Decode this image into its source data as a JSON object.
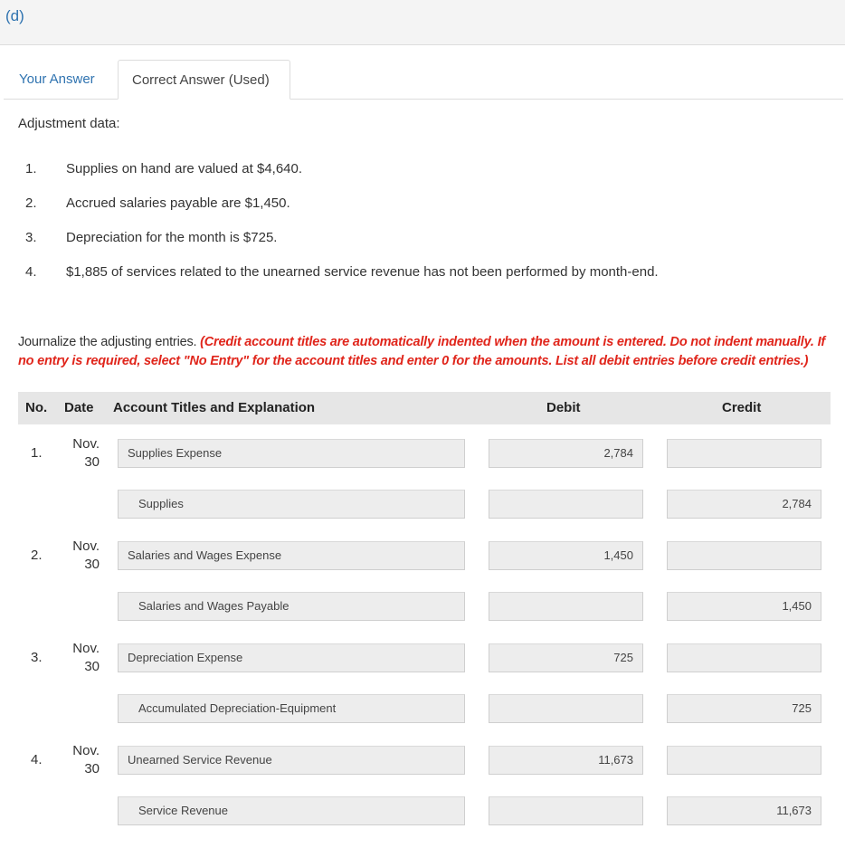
{
  "part": {
    "label": "(d)"
  },
  "tabs": [
    {
      "label": "Your Answer",
      "active": false
    },
    {
      "label": "Correct Answer (Used)",
      "active": true
    }
  ],
  "adjustment": {
    "title": "Adjustment data:",
    "items": [
      {
        "num": "1.",
        "text": "Supplies on hand are valued at $4,640."
      },
      {
        "num": "2.",
        "text": "Accrued salaries payable are $1,450."
      },
      {
        "num": "3.",
        "text": "Depreciation for the month is $725."
      },
      {
        "num": "4.",
        "text": "$1,885 of services related to the unearned service revenue has not been performed by month-end."
      }
    ]
  },
  "instructions": {
    "text": "Journalize the adjusting entries. ",
    "note": "(Credit account titles are automatically indented when the amount is entered. Do not indent manually. If no entry is required, select \"No Entry\" for the account titles and enter 0 for the amounts. List all debit entries before credit entries.)"
  },
  "table": {
    "headers": {
      "no": "No.",
      "date": "Date",
      "account": "Account Titles and Explanation",
      "debit": "Debit",
      "credit": "Credit"
    },
    "entries": [
      {
        "no": "1.",
        "date_month": "Nov.",
        "date_day": "30",
        "debit_line": {
          "account": "Supplies Expense",
          "debit": "2,784",
          "credit": ""
        },
        "credit_line": {
          "account": "Supplies",
          "debit": "",
          "credit": "2,784"
        }
      },
      {
        "no": "2.",
        "date_month": "Nov.",
        "date_day": "30",
        "debit_line": {
          "account": "Salaries and Wages Expense",
          "debit": "1,450",
          "credit": ""
        },
        "credit_line": {
          "account": "Salaries and Wages Payable",
          "debit": "",
          "credit": "1,450"
        }
      },
      {
        "no": "3.",
        "date_month": "Nov.",
        "date_day": "30",
        "debit_line": {
          "account": "Depreciation Expense",
          "debit": "725",
          "credit": ""
        },
        "credit_line": {
          "account": "Accumulated Depreciation-Equipment",
          "debit": "",
          "credit": "725"
        }
      },
      {
        "no": "4.",
        "date_month": "Nov.",
        "date_day": "30",
        "debit_line": {
          "account": "Unearned Service Revenue",
          "debit": "11,673",
          "credit": ""
        },
        "credit_line": {
          "account": "Service Revenue",
          "debit": "",
          "credit": "11,673"
        }
      }
    ]
  }
}
